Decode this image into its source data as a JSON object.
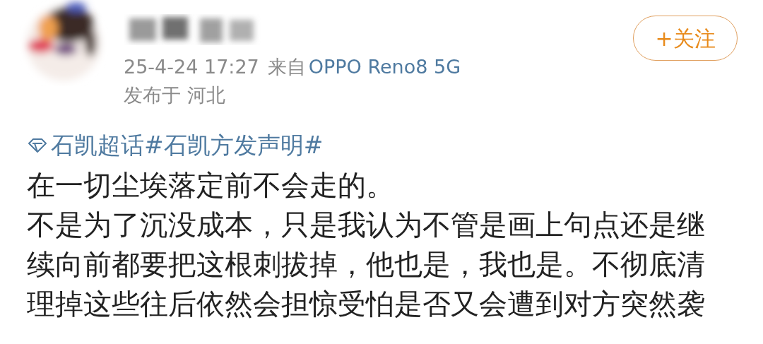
{
  "post": {
    "timestamp": "25-4-24 17:27",
    "source_prefix": "来自",
    "source_device": "OPPO Reno8 5G",
    "location": "发布于 河北",
    "follow_button": "+关注",
    "hashtags": "石凯超话#石凯方发声明#",
    "paragraphs": [
      "在一切尘埃落定前不会走的。",
      "不是为了沉没成本，只是我认为不管是画上句点还是继续向前都要把这根刺拔掉，他也是，我也是。不彻底清理掉这些往后依然会担惊受怕是否又会遭到对方突然袭"
    ]
  }
}
